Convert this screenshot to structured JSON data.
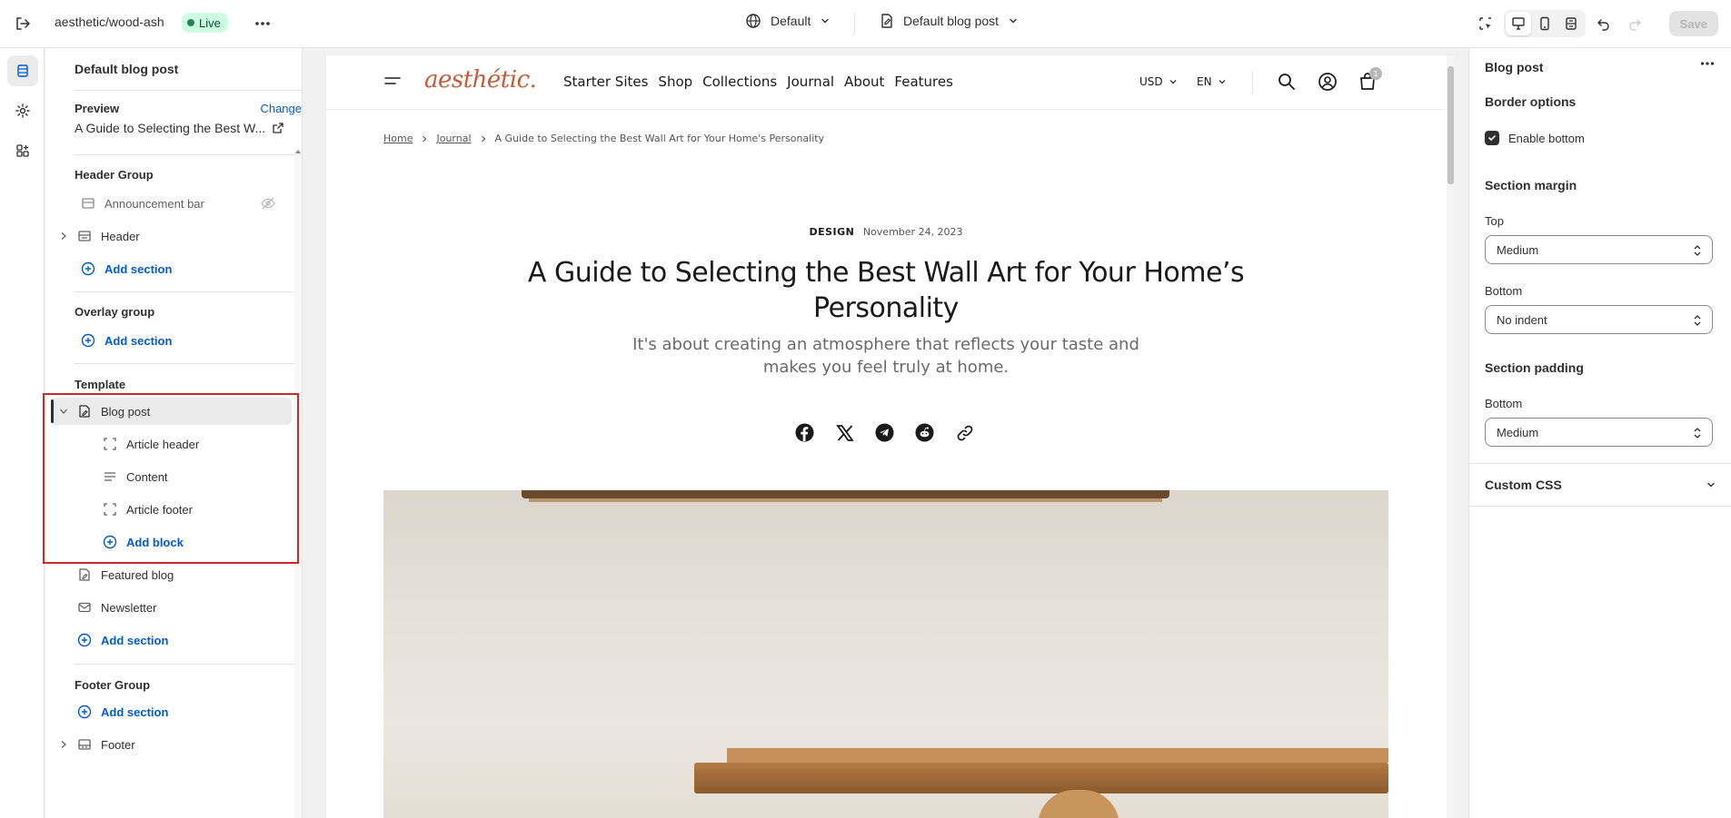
{
  "topbar": {
    "store_name": "aesthetic/wood-ash",
    "status": "Live",
    "theme_label": "Default",
    "template_label": "Default blog post",
    "save_label": "Save"
  },
  "sidebar": {
    "title": "Default blog post",
    "preview_label": "Preview",
    "change_label": "Change",
    "preview_value": "A Guide to Selecting the Best W...",
    "header_group": {
      "title": "Header Group",
      "items": [
        "Announcement bar",
        "Header"
      ],
      "add_label": "Add section"
    },
    "overlay_group": {
      "title": "Overlay group",
      "add_label": "Add section"
    },
    "template": {
      "title": "Template",
      "section": "Blog post",
      "blocks": [
        "Article header",
        "Content",
        "Article footer"
      ],
      "add_block_label": "Add block",
      "sections": [
        "Featured blog",
        "Newsletter"
      ],
      "add_label": "Add section"
    },
    "footer_group": {
      "title": "Footer Group",
      "add_label": "Add section",
      "items": [
        "Footer"
      ]
    }
  },
  "preview": {
    "logo": "aesthétic.",
    "nav": [
      "Starter Sites",
      "Shop",
      "Collections",
      "Journal",
      "About",
      "Features"
    ],
    "currency": "USD",
    "language": "EN",
    "cart_count": "1",
    "breadcrumb": [
      "Home",
      "Journal",
      "A Guide to Selecting the Best Wall Art for Your Home's Personality"
    ],
    "category": "DESIGN",
    "date": "November 24, 2023",
    "title": "A Guide to Selecting the Best Wall Art for Your Home’s Personality",
    "subtitle": "It's about creating an atmosphere that reflects your taste and makes you feel truly at home."
  },
  "settings": {
    "title": "Blog post",
    "border_options": "Border options",
    "enable_bottom": "Enable bottom",
    "section_margin": "Section margin",
    "top_label": "Top",
    "top_value": "Medium",
    "bottom_label": "Bottom",
    "bottom_value": "No indent",
    "section_padding": "Section padding",
    "padding_bottom_label": "Bottom",
    "padding_bottom_value": "Medium",
    "custom_css": "Custom CSS"
  },
  "colors": {
    "accent": "#005bd3",
    "logo": "#c75b39",
    "highlight": "#c62a2a",
    "live_bg": "#cdfee1"
  }
}
